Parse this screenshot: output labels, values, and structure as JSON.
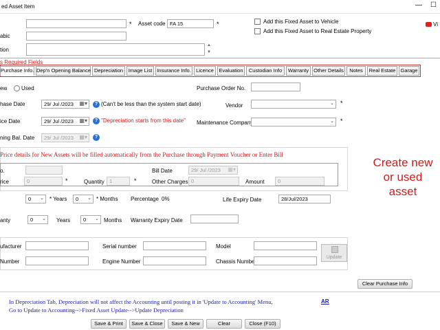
{
  "window": {
    "title": "ed Asset Item",
    "minimize_label": "—",
    "maximize_label": "☐"
  },
  "header": {
    "asset_code_label": "Asset code",
    "asset_code_value": "FA 15",
    "arabic_label": "abic",
    "description_label": "tion",
    "add_vehicle_label": "Add this Fixed Asset to Vehicle",
    "add_real_estate_label": "Add this Fixed Asset to Real Estate Property",
    "video_label": "Vi",
    "required_fields_label": "s Required Fields",
    "required_marker": "*"
  },
  "tabs": [
    "Purchase Info.",
    "Dep'n Opening Balance",
    "Depreciation",
    "Image List",
    "Insurance Info.",
    "Licence",
    "Evaluation",
    "Custodian Info",
    "Warranty",
    "Other Details",
    "Notes",
    "Real Estate",
    "Garage"
  ],
  "purchase": {
    "new_label": "ew",
    "used_label": "Used",
    "purchase_order_label": "Purchase Order No.",
    "purchase_date_label": "hase Date",
    "purchase_date_value": "29/ Jul /2023",
    "purchase_date_note": "(Can't be less than the system start date)",
    "vendor_label": "Vendor",
    "service_date_label": "ice Date",
    "service_date_value": "29/ Jul /2023",
    "service_date_note": "\"Depreciation starts from this date\"",
    "maintenance_label": "Maintenance Company",
    "opening_bal_label": "ning Bal. Date",
    "opening_bal_value": "29/ Jul /2023",
    "price_notice": "Price details for New Assets will be filled automatically from the Purchase through Payment Voucher or Enter Bill",
    "no_label": "o.",
    "bill_date_label": "Bill Date",
    "bill_date_value": "29/ Jul /2023",
    "price_label": "rice",
    "price_value": "0",
    "quantity_label": "Quantity",
    "quantity_value": "1",
    "other_charges_label": "Other Charges",
    "other_charges_value": "0",
    "amount_label": "Amount",
    "amount_value": "0"
  },
  "life": {
    "years_value": "0",
    "years_label": "Years",
    "months_value": "0",
    "months_label": "Months",
    "percentage_label": "Percentage",
    "percentage_value": "0%",
    "life_expiry_label": "Life Expiry Date",
    "life_expiry_value": "28/Jul/2023",
    "warranty_label": "anty",
    "w_years_value": "0",
    "w_years_label": "Years",
    "w_months_value": "0",
    "w_months_label": "Months",
    "warranty_expiry_label": "Warranty Expiry Date"
  },
  "details": {
    "manufacturer_label": "ufacturer",
    "serial_label": "Serial number",
    "model_label": "Model",
    "number_label": "Number",
    "engine_label": "Engine Number",
    "chassis_label": "Chassis Number",
    "update_label": "Update",
    "clear_purchase_label": "Clear Purchase Info"
  },
  "side_note": [
    "Create new",
    "or used",
    "asset"
  ],
  "footer": {
    "note_line1": "In Depreciation Tab, Depreciation will not affect the Accounting until posting it in 'Update to Accounting' Menu,",
    "note_line2": "Go to Update to Accounting-->Fixed Asset Update-->Update Depreciation",
    "ar_link": "AR",
    "buttons": [
      "Save & Print",
      "Save & Close",
      "Save & New",
      "Clear",
      "Close (F10)"
    ]
  },
  "colors": {
    "red": "#d11b1b",
    "blue_text": "#1a1aa8",
    "tab_highlight": "#c83232"
  }
}
